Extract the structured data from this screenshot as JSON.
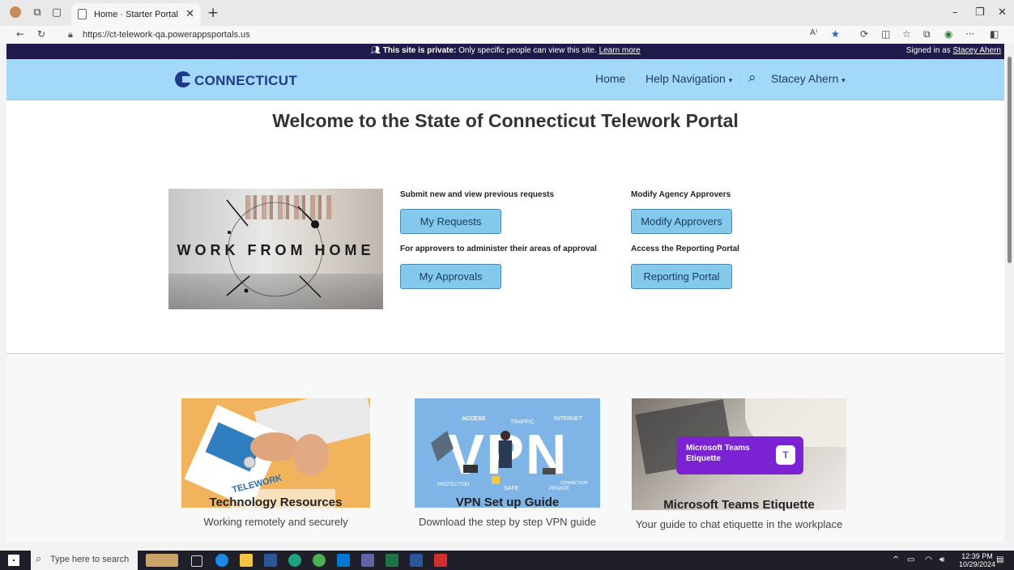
{
  "browser": {
    "tab_title": "Home · Starter Portal",
    "url": "https://ct-telework-qa.powerappsportals.us"
  },
  "privacy_bar": {
    "bold": "This site is private:",
    "text": " Only specific people can view this site. ",
    "link": "Learn more",
    "signed_prefix": "Signed in as ",
    "signed_user": "Stacey Ahern"
  },
  "header": {
    "logo_text": "CONNECTICUT",
    "nav": {
      "home": "Home",
      "help": "Help Navigation",
      "user": "Stacey Ahern"
    }
  },
  "main": {
    "welcome": "Welcome to the State of Connecticut Telework Portal",
    "hero_image_text": "WORK FROM HOME",
    "actions": {
      "submit_label": "Submit new and view previous requests",
      "my_requests": "My Requests",
      "approvers_label": "For approvers to administer their areas of approval",
      "my_approvals": "My Approvals",
      "modify_label": "Modify Agency Approvers",
      "modify_approvers": "Modify Approvers",
      "reporting_label": "Access the Reporting Portal",
      "reporting_portal": "Reporting Portal"
    }
  },
  "resources": [
    {
      "title": "Technology Resources",
      "desc": "Working remotely and securely",
      "image_text": "TELEWORK"
    },
    {
      "title": "VPN Set up Guide",
      "desc": "Download the step by step VPN guide",
      "image_text": "VPN",
      "image_labels": [
        "ACCESS",
        "TRAFFIC",
        "INTERNET",
        "PROTECTION",
        "SAFE",
        "CONNECTION",
        "PRIVATE"
      ]
    },
    {
      "title": "Microsoft Teams Etiquette",
      "desc": "Your guide to chat etiquette in the workplace",
      "image_text": "Microsoft Teams Etiquette"
    }
  ],
  "taskbar": {
    "search_placeholder": "Type here to search",
    "time": "12:39 PM",
    "date": "10/29/2024"
  },
  "colors": {
    "privacy_bar": "#1e1b4b",
    "header_bg": "#a3d9f8",
    "button_bg": "#83c9ec",
    "logo_blue": "#1f3a8a"
  }
}
